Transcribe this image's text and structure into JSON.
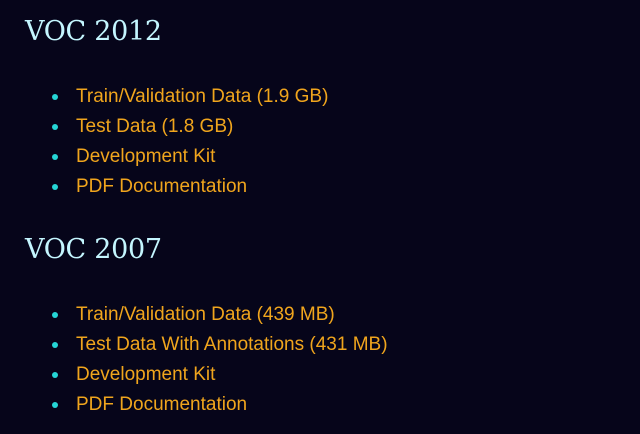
{
  "sections": [
    {
      "title": "VOC 2012",
      "links": [
        {
          "label": "Train/Validation Data (1.9 GB)"
        },
        {
          "label": "Test Data (1.8 GB)"
        },
        {
          "label": "Development Kit"
        },
        {
          "label": "PDF Documentation"
        }
      ]
    },
    {
      "title": "VOC 2007",
      "links": [
        {
          "label": "Train/Validation Data (439 MB)"
        },
        {
          "label": "Test Data With Annotations (431 MB)"
        },
        {
          "label": "Development Kit"
        },
        {
          "label": "PDF Documentation"
        }
      ]
    }
  ],
  "colors": {
    "background": "#06051a",
    "heading": "#c4f6ff",
    "link": "#f0a51d",
    "bullet": "#25d6d6"
  }
}
